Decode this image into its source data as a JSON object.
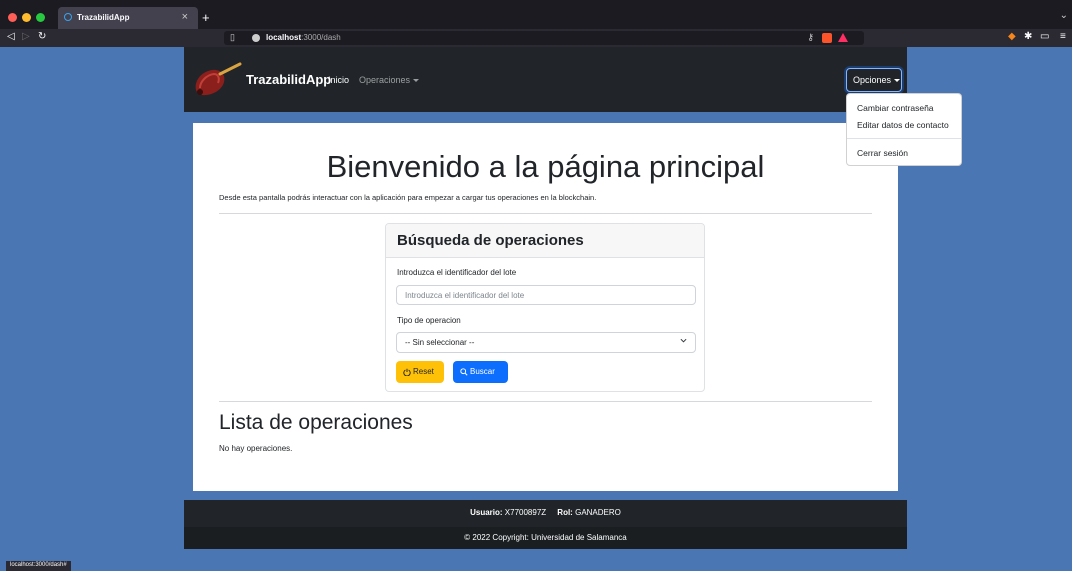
{
  "browser": {
    "tab_title": "TrazabilidApp",
    "tab_close": "×",
    "new_tab": "+",
    "url_host": "localhost",
    "url_path": ":3000/dash",
    "status_url": "localhost:3000/dash#"
  },
  "navbar": {
    "brand": "TrazabilidApp",
    "inicio": "Inicio",
    "operaciones": "Operaciones",
    "opciones": "Opciones"
  },
  "dropdown": {
    "items": [
      "Cambiar contraseña",
      "Editar datos de contacto",
      "Cerrar sesión"
    ]
  },
  "main": {
    "title": "Bienvenido a la página principal",
    "lead": "Desde esta pantalla podrás interactuar con la aplicación para empezar a cargar tus operaciones en la blockchain."
  },
  "search": {
    "title": "Búsqueda de operaciones",
    "lote_label": "Introduzca el identificador del lote",
    "lote_placeholder": "Introduzca el identificador del lote",
    "tipo_label": "Tipo de operacion",
    "tipo_value": "-- Sin seleccionar --",
    "reset_label": "Reset",
    "buscar_label": "Buscar"
  },
  "list": {
    "title": "Lista de operaciones",
    "empty": "No hay operaciones."
  },
  "footer": {
    "usuario_label": "Usuario:",
    "usuario_value": "X7700897Z",
    "rol_label": "Rol:",
    "rol_value": "GANADERO",
    "copyright": "© 2022 Copyright: Universidad de Salamanca"
  },
  "colors": {
    "page_bg": "#4a77b4",
    "navbar_bg": "#212529",
    "reset": "#ffc107",
    "buscar": "#0d6efd"
  }
}
